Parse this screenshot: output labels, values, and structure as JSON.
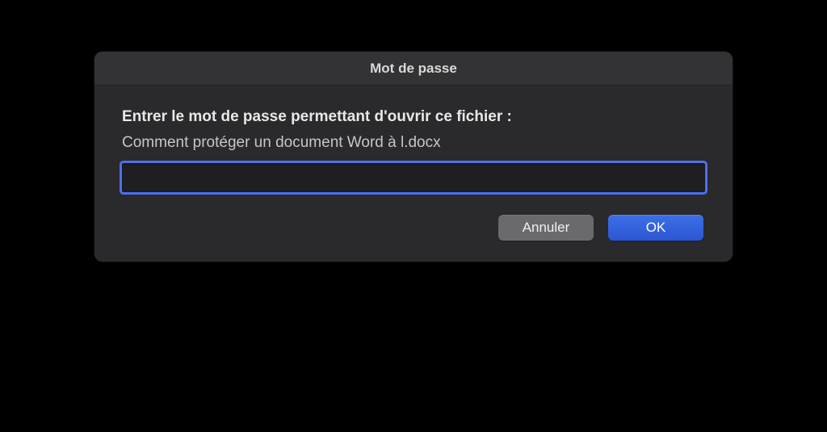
{
  "dialog": {
    "title": "Mot de passe",
    "prompt": "Entrer le mot de passe permettant d'ouvrir ce fichier :",
    "filename": "Comment protéger un document Word à l.docx",
    "password_value": "",
    "buttons": {
      "cancel": "Annuler",
      "ok": "OK"
    }
  }
}
